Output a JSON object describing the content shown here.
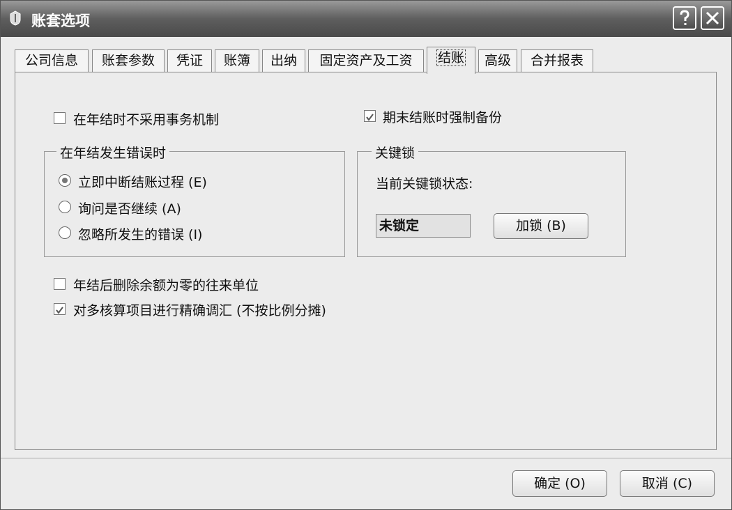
{
  "window": {
    "title": "账套选项",
    "app_icon": "app-icon",
    "help_label": "?",
    "close_label": "×"
  },
  "tabs": [
    {
      "label": "公司信息"
    },
    {
      "label": "账套参数"
    },
    {
      "label": "凭证"
    },
    {
      "label": "账簿"
    },
    {
      "label": "出纳"
    },
    {
      "label": "固定资产及工资"
    },
    {
      "label": "结账",
      "active": true
    },
    {
      "label": "高级"
    },
    {
      "label": "合并报表"
    }
  ],
  "options": {
    "no_transaction": {
      "label": "在年结时不采用事务机制",
      "checked": false
    },
    "force_backup": {
      "label": "期末结账时强制备份",
      "checked": true
    },
    "delete_zero_balance": {
      "label": "年结后删除余额为零的往来单位",
      "checked": false
    },
    "precise_reconcile": {
      "label": "对多核算项目进行精确调汇 (不按比例分摊)",
      "checked": true
    }
  },
  "error_group": {
    "title": "在年结发生错误时",
    "radios": [
      {
        "label": "立即中断结账过程 (E)",
        "selected": true
      },
      {
        "label": "询问是否继续 (A)",
        "selected": false
      },
      {
        "label": "忽略所发生的错误 (I)",
        "selected": false
      }
    ]
  },
  "lock_group": {
    "title": "关键锁",
    "status_label": "当前关键锁状态:",
    "status_value": "未锁定",
    "lock_button": "加锁 (B)"
  },
  "footer": {
    "ok": "确定 (O)",
    "cancel": "取消 (C)"
  }
}
